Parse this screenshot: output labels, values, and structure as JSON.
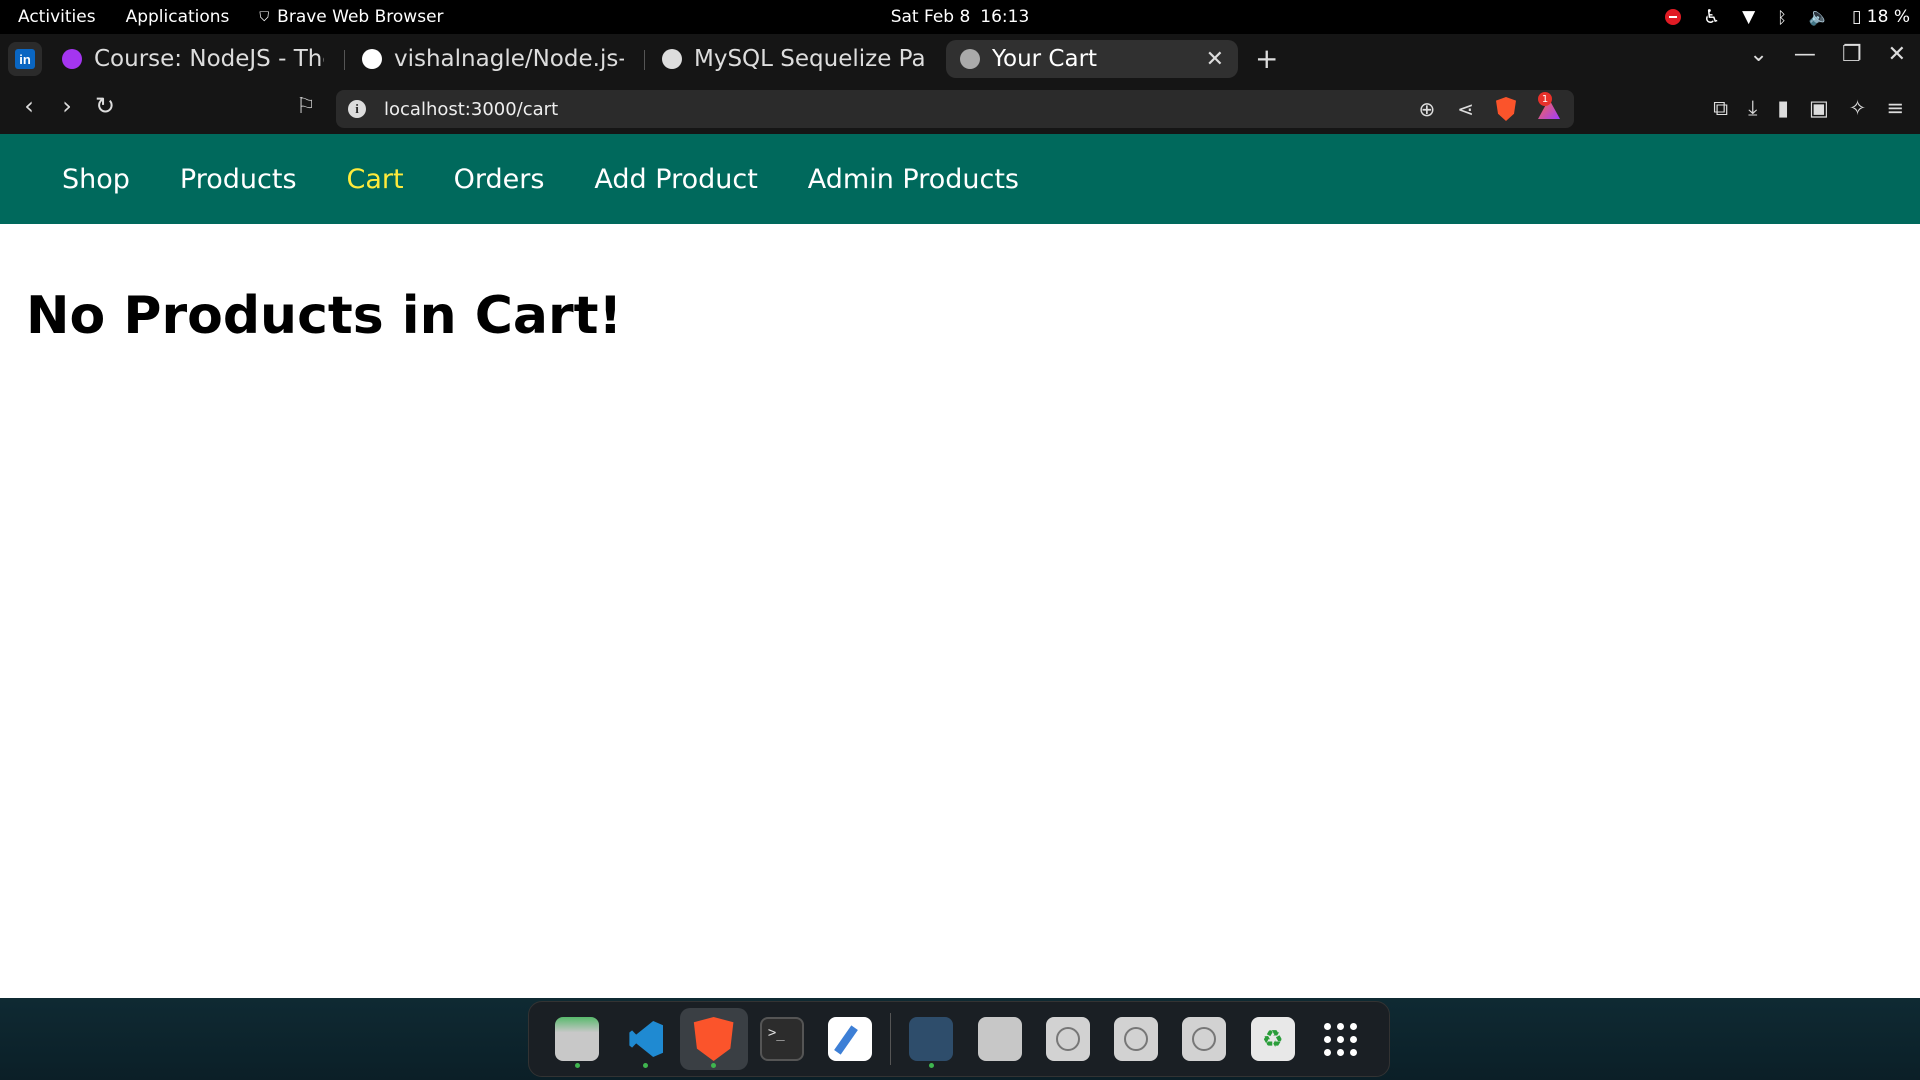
{
  "system": {
    "activities": "Activities",
    "applications": "Applications",
    "app_name": "Brave Web Browser",
    "date": "Sat Feb 8",
    "time": "16:13",
    "battery": "18 %"
  },
  "tabs": [
    {
      "title": "Course: NodeJS - The",
      "favicon_color": "#a435f0"
    },
    {
      "title": "vishalnagle/Node.js-M",
      "favicon_color": "#ffffff"
    },
    {
      "title": "MySQL Sequelize Pass",
      "favicon_color": "#dddddd"
    },
    {
      "title": "Your Cart",
      "favicon_color": "#aaaaaa",
      "active": true
    }
  ],
  "pinned_tab": {
    "label": "in"
  },
  "address": {
    "url": "localhost:3000/cart"
  },
  "notification_badge": "1",
  "nav": {
    "items": [
      "Shop",
      "Products",
      "Cart",
      "Orders",
      "Add Product",
      "Admin Products"
    ],
    "active": "Cart",
    "bg_color": "#00695c",
    "active_color": "#ffeb3b"
  },
  "page": {
    "heading": "No Products in Cart!"
  },
  "dock": {
    "apps": [
      "files-icon",
      "vscode-icon",
      "brave-icon",
      "terminal-icon",
      "text-editor-icon",
      "mysql-workbench-icon",
      "app-icon",
      "disc-icon",
      "disc-icon",
      "disc-icon",
      "trash-icon",
      "app-grid-icon"
    ]
  }
}
